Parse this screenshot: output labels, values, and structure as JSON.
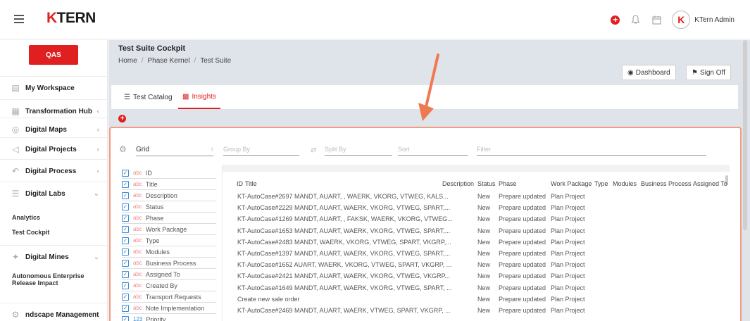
{
  "app": {
    "brand_k": "K",
    "brand_rest": "TERN",
    "username": "KTern Admin",
    "avatar_letter": "K"
  },
  "topbar_icons": [
    "plus-icon",
    "bell-icon",
    "calendar-icon"
  ],
  "sidebar": {
    "env_label": "QAS",
    "items": [
      {
        "label": "My Workspace",
        "icon": "workspace-icon"
      },
      {
        "label": "Transformation Hub",
        "icon": "transformation-icon"
      },
      {
        "label": "Digital Maps",
        "icon": "maps-icon"
      },
      {
        "label": "Digital Projects",
        "icon": "projects-icon"
      },
      {
        "label": "Digital Process",
        "icon": "process-icon"
      },
      {
        "label": "Digital Labs",
        "icon": "labs-icon"
      },
      {
        "label": "Digital Mines",
        "icon": "mines-icon"
      },
      {
        "label": "ndscape Management",
        "icon": "landscape-icon"
      }
    ],
    "sub_items": [
      "Analytics",
      "Test Cockpit",
      "Autonomous Enterprise Release Impact"
    ]
  },
  "header": {
    "title": "Test Suite Cockpit",
    "breadcrumb": [
      "Home",
      "Phase Kernel",
      "Test Suite"
    ],
    "dashboard_label": "Dashboard",
    "signoff_label": "Sign Off"
  },
  "tabs": [
    {
      "label": "Test Catalog"
    },
    {
      "label": "Insights"
    }
  ],
  "toolbar": {
    "view": "Grid",
    "group_by": "Group By",
    "split_by": "Split By",
    "sort": "Sort",
    "filter": "Filter"
  },
  "columns_list": [
    {
      "type": "abc",
      "label": "ID"
    },
    {
      "type": "abc",
      "label": "Title"
    },
    {
      "type": "abc",
      "label": "Description"
    },
    {
      "type": "abc",
      "label": "Status"
    },
    {
      "type": "abc",
      "label": "Phase"
    },
    {
      "type": "abc",
      "label": "Work Package"
    },
    {
      "type": "abc",
      "label": "Type"
    },
    {
      "type": "abc",
      "label": "Modules"
    },
    {
      "type": "abc",
      "label": "Business Process"
    },
    {
      "type": "abc",
      "label": "Assigned To"
    },
    {
      "type": "abc",
      "label": "Created By"
    },
    {
      "type": "abc",
      "label": "Transport Requests"
    },
    {
      "type": "abc",
      "label": "Note Implementation"
    },
    {
      "type": "123",
      "label": "Priority"
    }
  ],
  "grid": {
    "headers": [
      "ID",
      "Title",
      "Description",
      "Status",
      "Phase",
      "Work Package",
      "Type",
      "Modules",
      "Business Process",
      "Assigned To"
    ],
    "rows": [
      {
        "title": "KT-AutoCase#2697 MANDT, AUART, , WAERK, VKORG, VTWEG, KALS...",
        "status": "New",
        "phase": "Prepare updated",
        "wp": "Plan Project"
      },
      {
        "title": "KT-AutoCase#2229 MANDT, AUART, WAERK, VKORG, VTWEG, SPART,...",
        "status": "New",
        "phase": "Prepare updated",
        "wp": "Plan Project"
      },
      {
        "title": "KT-AutoCase#1269 MANDT, AUART, , FAKSK, WAERK, VKORG, VTWEG...",
        "status": "New",
        "phase": "Prepare updated",
        "wp": "Plan Project"
      },
      {
        "title": "KT-AutoCase#1653 MANDT, AUART, WAERK, VKORG, VTWEG, SPART,...",
        "status": "New",
        "phase": "Prepare updated",
        "wp": "Plan Project"
      },
      {
        "title": "KT-AutoCase#2483 MANDT, WAERK, VKORG, VTWEG, SPART, VKGRP,...",
        "status": "New",
        "phase": "Prepare updated",
        "wp": "Plan Project"
      },
      {
        "title": "KT-AutoCase#1397 MANDT, AUART, WAERK, VKORG, VTWEG, SPART,...",
        "status": "New",
        "phase": "Prepare updated",
        "wp": "Plan Project"
      },
      {
        "title": "KT-AutoCase#1652 AUART, WAERK, VKORG, VTWEG, SPART, VKGRP, ...",
        "status": "New",
        "phase": "Prepare updated",
        "wp": "Plan Project"
      },
      {
        "title": "KT-AutoCase#2421 MANDT, AUART, WAERK, VKORG, VTWEG, VKGRP...",
        "status": "New",
        "phase": "Prepare updated",
        "wp": "Plan Project"
      },
      {
        "title": "KT-AutoCase#1649 MANDT, AUART, WAERK, VKORG, VTWEG, SPART, ...",
        "status": "New",
        "phase": "Prepare updated",
        "wp": "Plan Project"
      },
      {
        "title": "Create new sale order",
        "status": "New",
        "phase": "Prepare updated",
        "wp": "Plan Project"
      },
      {
        "title": "KT-AutoCase#2469 MANDT, AUART, WAERK, VTWEG, SPART, VKGRP, ...",
        "status": "New",
        "phase": "Prepare updated",
        "wp": "Plan Project"
      }
    ]
  },
  "colors": {
    "accent": "#e02020",
    "highlight_border": "#f39c80",
    "checkbox": "#3a8dd8"
  }
}
